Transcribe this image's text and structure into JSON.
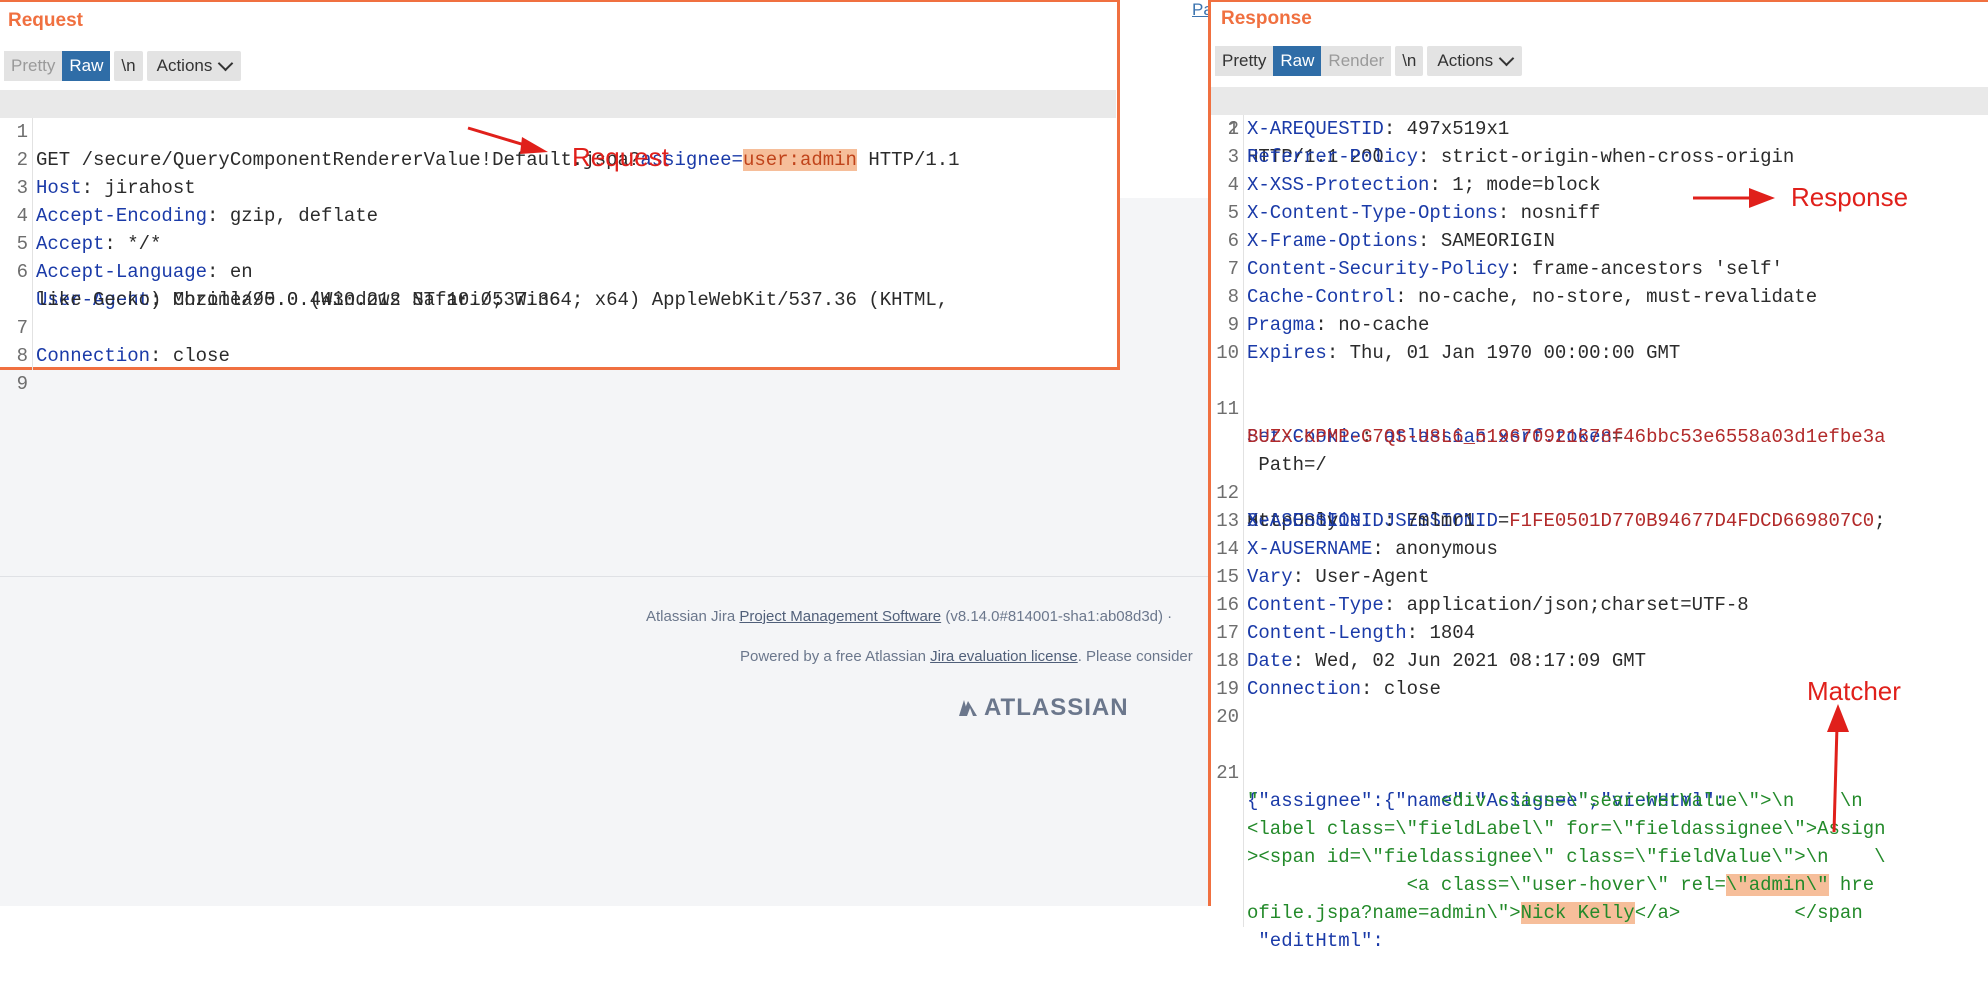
{
  "page": {
    "pa_link": "Pa",
    "footer": {
      "line1_prefix": "Atlassian Jira ",
      "line1_link": "Project Management Software",
      "line1_suffix": " (v8.14.0#814001-sha1:ab08d3d)   ·",
      "line2_prefix": "Powered by a free Atlassian ",
      "line2_link": "Jira evaluation license",
      "line2_suffix": ". Please consider",
      "logo_text": "ATLASSIAN"
    }
  },
  "request": {
    "title": "Request",
    "toolbar": {
      "pretty": "Pretty",
      "raw": "Raw",
      "newline": "\\n",
      "actions": "Actions"
    },
    "lines": [
      {
        "n": "1",
        "method": "GET /secure/QueryComponentRendererValue!Default.jspa?",
        "param": "assignee=",
        "value": "user:admin",
        "tail": " HTTP/1.1"
      },
      {
        "n": "2",
        "key": "Host",
        "val": ": jirahost"
      },
      {
        "n": "3",
        "key": "Accept-Encoding",
        "val": ": gzip, deflate"
      },
      {
        "n": "4",
        "key": "Accept",
        "val": ": */*"
      },
      {
        "n": "5",
        "key": "Accept-Language",
        "val": ": en"
      },
      {
        "n": "6",
        "key": "User-Agent",
        "val": ": Mozilla/5.0 (Windows NT 10.0; Win64; x64) AppleWebKit/537.36 (KHTML,",
        "cont": "like Gecko) Chrome/90.0.4430.212 Safari/537.36"
      },
      {
        "n": "7",
        "key": "Connection",
        "val": ": close"
      },
      {
        "n": "8"
      },
      {
        "n": "9"
      }
    ],
    "annotation": "Request"
  },
  "response": {
    "title": "Response",
    "toolbar": {
      "pretty": "Pretty",
      "raw": "Raw",
      "render": "Render",
      "newline": "\\n",
      "actions": "Actions"
    },
    "status_line": "HTTP/1.1 200",
    "headers": [
      {
        "n": "2",
        "key": "X-AREQUESTID",
        "val": ": 497x519x1"
      },
      {
        "n": "3",
        "key": "Referrer-Policy",
        "val": ": strict-origin-when-cross-origin"
      },
      {
        "n": "4",
        "key": "X-XSS-Protection",
        "val": ": 1; mode=block"
      },
      {
        "n": "5",
        "key": "X-Content-Type-Options",
        "val": ": nosniff"
      },
      {
        "n": "6",
        "key": "X-Frame-Options",
        "val": ": SAMEORIGIN"
      },
      {
        "n": "7",
        "key": "Content-Security-Policy",
        "val": ": frame-ancestors 'self'"
      },
      {
        "n": "8",
        "key": "Cache-Control",
        "val": ": no-cache, no-store, must-revalidate"
      },
      {
        "n": "9",
        "key": "Pragma",
        "val": ": no-cache"
      },
      {
        "n": "10",
        "key": "Expires",
        "val": ": Thu, 01 Jan 1970 00:00:00 GMT"
      }
    ],
    "cookie1": {
      "n": "11",
      "key": "Set-Cookie",
      "name": "atlassian.xsrf.token",
      "eq": "=",
      "value": "BUZX-KPMP-G7QS-U8L6_519670921678f46bbc53e6558a03d1efbe3a",
      "path": " Path=/"
    },
    "cookie2": {
      "n": "12",
      "key": "Set-Cookie",
      "name": "JSESSIONID",
      "eq": "=",
      "value": "F1FE0501D770B94677D4FDCD669807C0",
      "rest": ";",
      "cont": "HttpOnly"
    },
    "headers2": [
      {
        "n": "13",
        "key": "X-ASESSIONID",
        "val": ": 7mlmr1"
      },
      {
        "n": "14",
        "key": "X-AUSERNAME",
        "val": ": anonymous"
      },
      {
        "n": "15",
        "key": "Vary",
        "val": ": User-Agent"
      },
      {
        "n": "16",
        "key": "Content-Type",
        "val": ": application/json;charset=UTF-8"
      },
      {
        "n": "17",
        "key": "Content-Length",
        "val": ": 1804"
      },
      {
        "n": "18",
        "key": "Date",
        "val": ": Wed, 02 Jun 2021 08:17:09 GMT"
      },
      {
        "n": "19",
        "key": "Connection",
        "val": ": close"
      },
      {
        "n": "20"
      }
    ],
    "body": {
      "n": "21",
      "l1_a": "{\"assignee\":{\"name\":\"Assignee\",\"viewHtml\":",
      "l2": "\"                <div class=\\\"searcherValue\\\">\\n    \\n",
      "l3": "<label class=\\\"fieldLabel\\\" for=\\\"fieldassignee\\\">Assign",
      "l4": "><span id=\\\"fieldassignee\\\" class=\\\"fieldValue\\\">\\n    \\",
      "l5_a": "              <a class=\\\"user-hover\\\" rel=",
      "l5_mark": "\\\"admin\\\"",
      "l5_b": " hre",
      "l6_a": "ofile.jspa?name=admin\\\">",
      "l6_mark": "Nick Kelly",
      "l6_b": "</a>          </span",
      "l7": " \"editHtml\":"
    },
    "annotation": "Response",
    "matcher": "Matcher"
  }
}
